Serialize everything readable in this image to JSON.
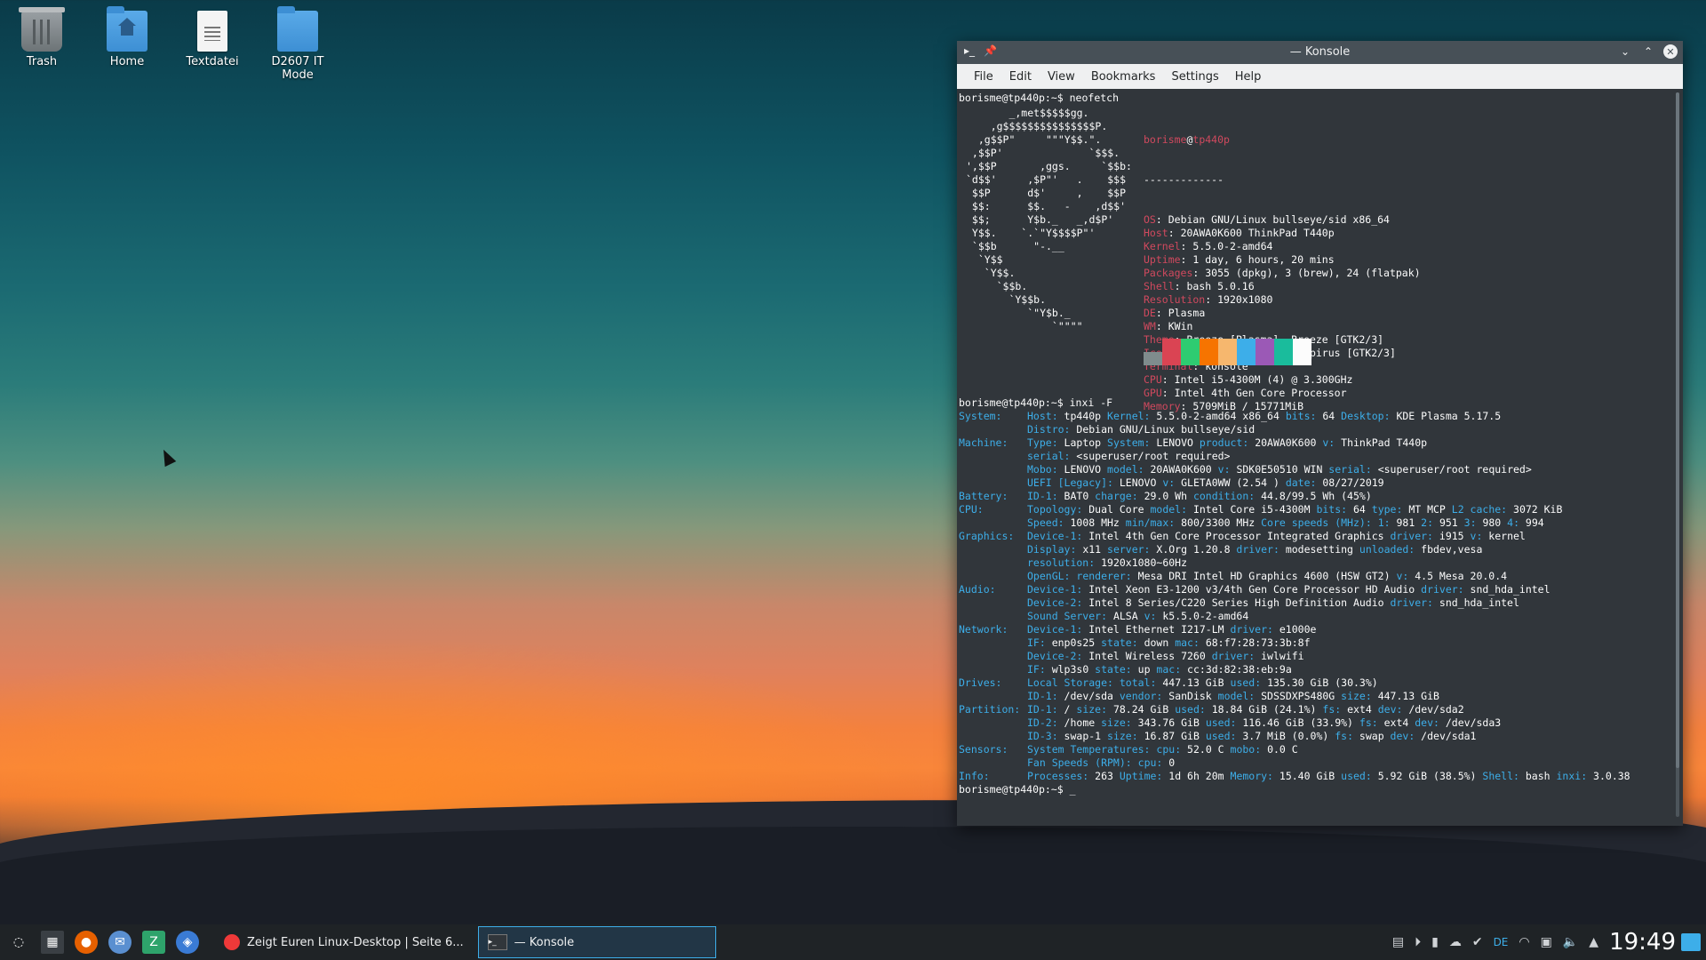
{
  "desktop": {
    "icons": [
      {
        "label": "Trash"
      },
      {
        "label": "Home"
      },
      {
        "label": "Textdatei"
      },
      {
        "label": "D2607 IT Mode"
      }
    ]
  },
  "konsole": {
    "title": "— Konsole",
    "menu": [
      "File",
      "Edit",
      "View",
      "Bookmarks",
      "Settings",
      "Help"
    ],
    "prompt1": "borisme@tp440p:~$ neofetch",
    "logo": [
      "       _,met$$$$$gg.",
      "    ,g$$$$$$$$$$$$$$$P.",
      "  ,g$$P\"     \"\"\"Y$$.\".",
      " ,$$P'              `$$$.",
      "',$$P       ,ggs.     `$$b:",
      "`d$$'     ,$P\"'   .    $$$",
      " $$P      d$'     ,    $$P",
      " $$:      $$.   -    ,d$$'",
      " $$;      Y$b._   _,d$P'",
      " Y$$.    `.`\"Y$$$$P\"'",
      " `$$b      \"-.__",
      "  `Y$$",
      "   `Y$$.",
      "     `$$b.",
      "       `Y$$b.",
      "          `\"Y$b._",
      "              `\"\"\"\""
    ],
    "user": "borisme",
    "host": "tp440p",
    "separator": "-------------",
    "info": [
      {
        "k": "OS",
        "v": "Debian GNU/Linux bullseye/sid x86_64"
      },
      {
        "k": "Host",
        "v": "20AWA0K600 ThinkPad T440p"
      },
      {
        "k": "Kernel",
        "v": "5.5.0-2-amd64"
      },
      {
        "k": "Uptime",
        "v": "1 day, 6 hours, 20 mins"
      },
      {
        "k": "Packages",
        "v": "3055 (dpkg), 3 (brew), 24 (flatpak)"
      },
      {
        "k": "Shell",
        "v": "bash 5.0.16"
      },
      {
        "k": "Resolution",
        "v": "1920x1080"
      },
      {
        "k": "DE",
        "v": "Plasma"
      },
      {
        "k": "WM",
        "v": "KWin"
      },
      {
        "k": "Theme",
        "v": "Breeze [Plasma], Breeze [GTK2/3]"
      },
      {
        "k": "Icons",
        "v": "Papirus [Plasma], Papirus [GTK2/3]"
      },
      {
        "k": "Terminal",
        "v": "konsole"
      },
      {
        "k": "CPU",
        "v": "Intel i5-4300M (4) @ 3.300GHz"
      },
      {
        "k": "GPU",
        "v": "Intel 4th Gen Core Processor"
      },
      {
        "k": "Memory",
        "v": "5709MiB / 15771MiB"
      }
    ],
    "swatch_colors": [
      "#7f8c8d",
      "#da4453",
      "#2ecc71",
      "#f67400",
      "#f6b76e",
      "#3daee9",
      "#9b59b6",
      "#1abc9c",
      "#fcfcfc"
    ],
    "prompt2": "borisme@tp440p:~$ inxi -F",
    "inxi": [
      {
        "sec": "System:",
        "parts": [
          [
            "Host:",
            " tp440p "
          ],
          [
            "Kernel:",
            " 5.5.0-2-amd64 x86_64 "
          ],
          [
            "bits:",
            " 64 "
          ],
          [
            "Desktop:",
            " KDE Plasma 5.17.5"
          ]
        ]
      },
      {
        "sec": "",
        "parts": [
          [
            "Distro:",
            " Debian GNU/Linux bullseye/sid"
          ]
        ]
      },
      {
        "sec": "Machine:",
        "parts": [
          [
            "Type:",
            " Laptop "
          ],
          [
            "System:",
            " LENOVO "
          ],
          [
            "product:",
            " 20AWA0K600 "
          ],
          [
            "v:",
            " ThinkPad T440p"
          ]
        ]
      },
      {
        "sec": "",
        "parts": [
          [
            "serial:",
            " <superuser/root required>"
          ]
        ]
      },
      {
        "sec": "",
        "parts": [
          [
            "Mobo:",
            " LENOVO "
          ],
          [
            "model:",
            " 20AWA0K600 "
          ],
          [
            "v:",
            " SDK0E50510 WIN "
          ],
          [
            "serial:",
            " <superuser/root required>"
          ]
        ]
      },
      {
        "sec": "",
        "parts": [
          [
            "UEFI [Legacy]:",
            " LENOVO "
          ],
          [
            "v:",
            " GLETA0WW (2.54 ) "
          ],
          [
            "date:",
            " 08/27/2019"
          ]
        ]
      },
      {
        "sec": "Battery:",
        "parts": [
          [
            "ID-1:",
            " BAT0 "
          ],
          [
            "charge:",
            " 29.0 Wh "
          ],
          [
            "condition:",
            " 44.8/99.5 Wh (45%)"
          ]
        ]
      },
      {
        "sec": "CPU:",
        "parts": [
          [
            "Topology:",
            " Dual Core "
          ],
          [
            "model:",
            " Intel Core i5-4300M "
          ],
          [
            "bits:",
            " 64 "
          ],
          [
            "type:",
            " MT MCP "
          ],
          [
            "L2 cache:",
            " 3072 KiB"
          ]
        ]
      },
      {
        "sec": "",
        "parts": [
          [
            "Speed:",
            " 1008 MHz "
          ],
          [
            "min/max:",
            " 800/3300 MHz "
          ],
          [
            "Core speeds (MHz):",
            " "
          ],
          [
            "1:",
            " 981 "
          ],
          [
            "2:",
            " 951 "
          ],
          [
            "3:",
            " 980 "
          ],
          [
            "4:",
            " 994"
          ]
        ]
      },
      {
        "sec": "Graphics:",
        "parts": [
          [
            "Device-1:",
            " Intel 4th Gen Core Processor Integrated Graphics "
          ],
          [
            "driver:",
            " i915 "
          ],
          [
            "v:",
            " kernel"
          ]
        ]
      },
      {
        "sec": "",
        "parts": [
          [
            "Display:",
            " x11 "
          ],
          [
            "server:",
            " X.Org 1.20.8 "
          ],
          [
            "driver:",
            " modesetting "
          ],
          [
            "unloaded:",
            " fbdev,vesa"
          ]
        ]
      },
      {
        "sec": "",
        "parts": [
          [
            "resolution:",
            " 1920x1080~60Hz"
          ]
        ]
      },
      {
        "sec": "",
        "parts": [
          [
            "OpenGL:",
            " "
          ],
          [
            "renderer:",
            " Mesa DRI Intel HD Graphics 4600 (HSW GT2) "
          ],
          [
            "v:",
            " 4.5 Mesa 20.0.4"
          ]
        ]
      },
      {
        "sec": "Audio:",
        "parts": [
          [
            "Device-1:",
            " Intel Xeon E3-1200 v3/4th Gen Core Processor HD Audio "
          ],
          [
            "driver:",
            " snd_hda_intel"
          ]
        ]
      },
      {
        "sec": "",
        "parts": [
          [
            "Device-2:",
            " Intel 8 Series/C220 Series High Definition Audio "
          ],
          [
            "driver:",
            " snd_hda_intel"
          ]
        ]
      },
      {
        "sec": "",
        "parts": [
          [
            "Sound Server:",
            " ALSA "
          ],
          [
            "v:",
            " k5.5.0-2-amd64"
          ]
        ]
      },
      {
        "sec": "Network:",
        "parts": [
          [
            "Device-1:",
            " Intel Ethernet I217-LM "
          ],
          [
            "driver:",
            " e1000e"
          ]
        ]
      },
      {
        "sec": "",
        "parts": [
          [
            "IF:",
            " enp0s25 "
          ],
          [
            "state:",
            " down "
          ],
          [
            "mac:",
            " 68:f7:28:73:3b:8f"
          ]
        ]
      },
      {
        "sec": "",
        "parts": [
          [
            "Device-2:",
            " Intel Wireless 7260 "
          ],
          [
            "driver:",
            " iwlwifi"
          ]
        ]
      },
      {
        "sec": "",
        "parts": [
          [
            "IF:",
            " wlp3s0 "
          ],
          [
            "state:",
            " up "
          ],
          [
            "mac:",
            " cc:3d:82:38:eb:9a"
          ]
        ]
      },
      {
        "sec": "Drives:",
        "parts": [
          [
            "Local Storage:",
            " "
          ],
          [
            "total:",
            " 447.13 GiB "
          ],
          [
            "used:",
            " 135.30 GiB (30.3%)"
          ]
        ]
      },
      {
        "sec": "",
        "parts": [
          [
            "ID-1:",
            " /dev/sda "
          ],
          [
            "vendor:",
            " SanDisk "
          ],
          [
            "model:",
            " SDSSDXPS480G "
          ],
          [
            "size:",
            " 447.13 GiB"
          ]
        ]
      },
      {
        "sec": "Partition:",
        "parts": [
          [
            "ID-1:",
            " / "
          ],
          [
            "size:",
            " 78.24 GiB "
          ],
          [
            "used:",
            " 18.84 GiB (24.1%) "
          ],
          [
            "fs:",
            " ext4 "
          ],
          [
            "dev:",
            " /dev/sda2"
          ]
        ]
      },
      {
        "sec": "",
        "parts": [
          [
            "ID-2:",
            " /home "
          ],
          [
            "size:",
            " 343.76 GiB "
          ],
          [
            "used:",
            " 116.46 GiB (33.9%) "
          ],
          [
            "fs:",
            " ext4 "
          ],
          [
            "dev:",
            " /dev/sda3"
          ]
        ]
      },
      {
        "sec": "",
        "parts": [
          [
            "ID-3:",
            " swap-1 "
          ],
          [
            "size:",
            " 16.87 GiB "
          ],
          [
            "used:",
            " 3.7 MiB (0.0%) "
          ],
          [
            "fs:",
            " swap "
          ],
          [
            "dev:",
            " /dev/sda1"
          ]
        ]
      },
      {
        "sec": "Sensors:",
        "parts": [
          [
            "System Temperatures:",
            " "
          ],
          [
            "cpu:",
            " 52.0 C "
          ],
          [
            "mobo:",
            " 0.0 C"
          ]
        ]
      },
      {
        "sec": "",
        "parts": [
          [
            "Fan Speeds (RPM):",
            " "
          ],
          [
            "cpu:",
            " 0"
          ]
        ]
      },
      {
        "sec": "Info:",
        "parts": [
          [
            "Processes:",
            " 263 "
          ],
          [
            "Uptime:",
            " 1d 6h 20m "
          ],
          [
            "Memory:",
            " 15.40 GiB "
          ],
          [
            "used:",
            " 5.92 GiB (38.5%) "
          ],
          [
            "Shell:",
            " bash "
          ],
          [
            "inxi:",
            " 3.0.38"
          ]
        ]
      }
    ],
    "prompt3": "borisme@tp440p:~$ _"
  },
  "taskbar": {
    "tasks": [
      {
        "label": "Zeigt Euren Linux-Desktop | Seite 6..."
      },
      {
        "label": "— Konsole"
      }
    ],
    "keyboard_layout": "DE",
    "clock": "19:49"
  }
}
